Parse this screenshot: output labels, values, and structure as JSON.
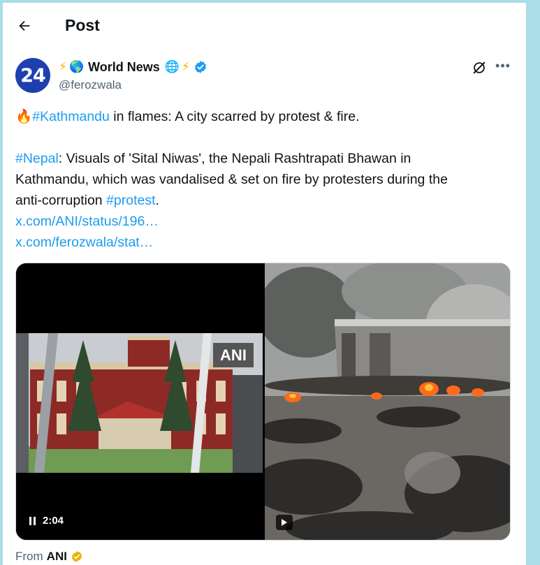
{
  "header": {
    "title": "Post"
  },
  "author": {
    "avatar_text": "24",
    "name_prefix_emojis": [
      "⚡",
      "🌎"
    ],
    "name": "World News",
    "name_suffix_emojis": [
      "🌐",
      "⚡"
    ],
    "handle": "@ferozwala",
    "verified": true
  },
  "post": {
    "line1_emoji": "🔥",
    "line1_hashtag": "#Kathmandu",
    "line1_text": " in flames: A city scarred by protest & fire.",
    "line2_hashtag": "#Nepal",
    "line2_text": ": Visuals of 'Sital Niwas', the Nepali Rashtrapati Bhawan in",
    "line3_text": "Kathmandu, which was vandalised & set on fire by protesters during the",
    "line4_text": "anti-corruption ",
    "line4_hashtag": "#protest",
    "line4_end": ".",
    "link1": "x.com/ANI/status/196…",
    "link2": "x.com/ferozwala/stat…"
  },
  "media": {
    "left_video": {
      "watermark": "ANI",
      "time": "2:04",
      "state": "paused"
    },
    "right_video": {
      "state": "play"
    }
  },
  "footer": {
    "from_label": "From",
    "from_source": "ANI"
  },
  "colors": {
    "link": "#1d9bf0",
    "verified_blue": "#1d9bf0",
    "verified_gold": "#e8b400",
    "frame": "#a9dde8",
    "avatar_bg": "#1d3fb0"
  },
  "icons": {
    "back": "arrow-left-icon",
    "grok": "grok-icon",
    "more": "more-icon",
    "verified": "verified-badge-icon"
  }
}
